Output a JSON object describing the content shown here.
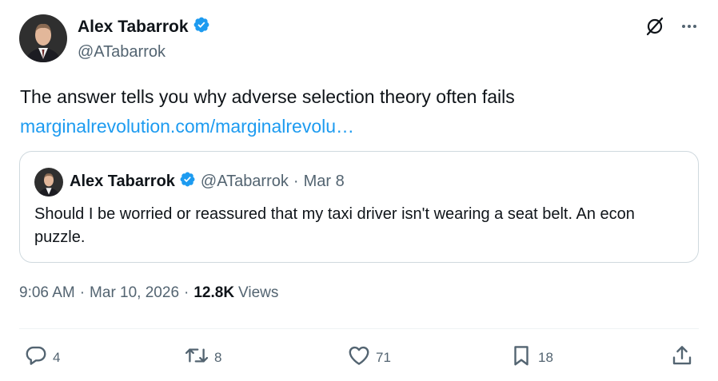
{
  "author": {
    "name": "Alex Tabarrok",
    "handle": "@ATabarrok"
  },
  "tweet": {
    "text": "The answer tells you why adverse selection theory often fails",
    "link": "marginalrevolution.com/marginalrevolu…"
  },
  "quote": {
    "name": "Alex Tabarrok",
    "handle": "@ATabarrok",
    "separator": "·",
    "date": "Mar 8",
    "text": "Should I be worried or reassured that my taxi driver isn't wearing a seat belt. An econ puzzle."
  },
  "meta": {
    "time": "9:06 AM",
    "separator": "·",
    "date": "Mar 10, 2026",
    "views_count": "12.8K",
    "views_label": "Views"
  },
  "actions": {
    "replies": "4",
    "reposts": "8",
    "likes": "71",
    "bookmarks": "18"
  },
  "icons": {
    "verified": "verified-badge-icon",
    "grok": "grok-icon",
    "more": "more-icon",
    "reply": "reply-icon",
    "repost": "repost-icon",
    "like": "like-icon",
    "bookmark": "bookmark-icon",
    "share": "share-icon"
  },
  "colors": {
    "verified": "#1d9bf0",
    "link": "#1d9bf0",
    "secondary_text": "#536471",
    "border": "#cfd9de"
  }
}
